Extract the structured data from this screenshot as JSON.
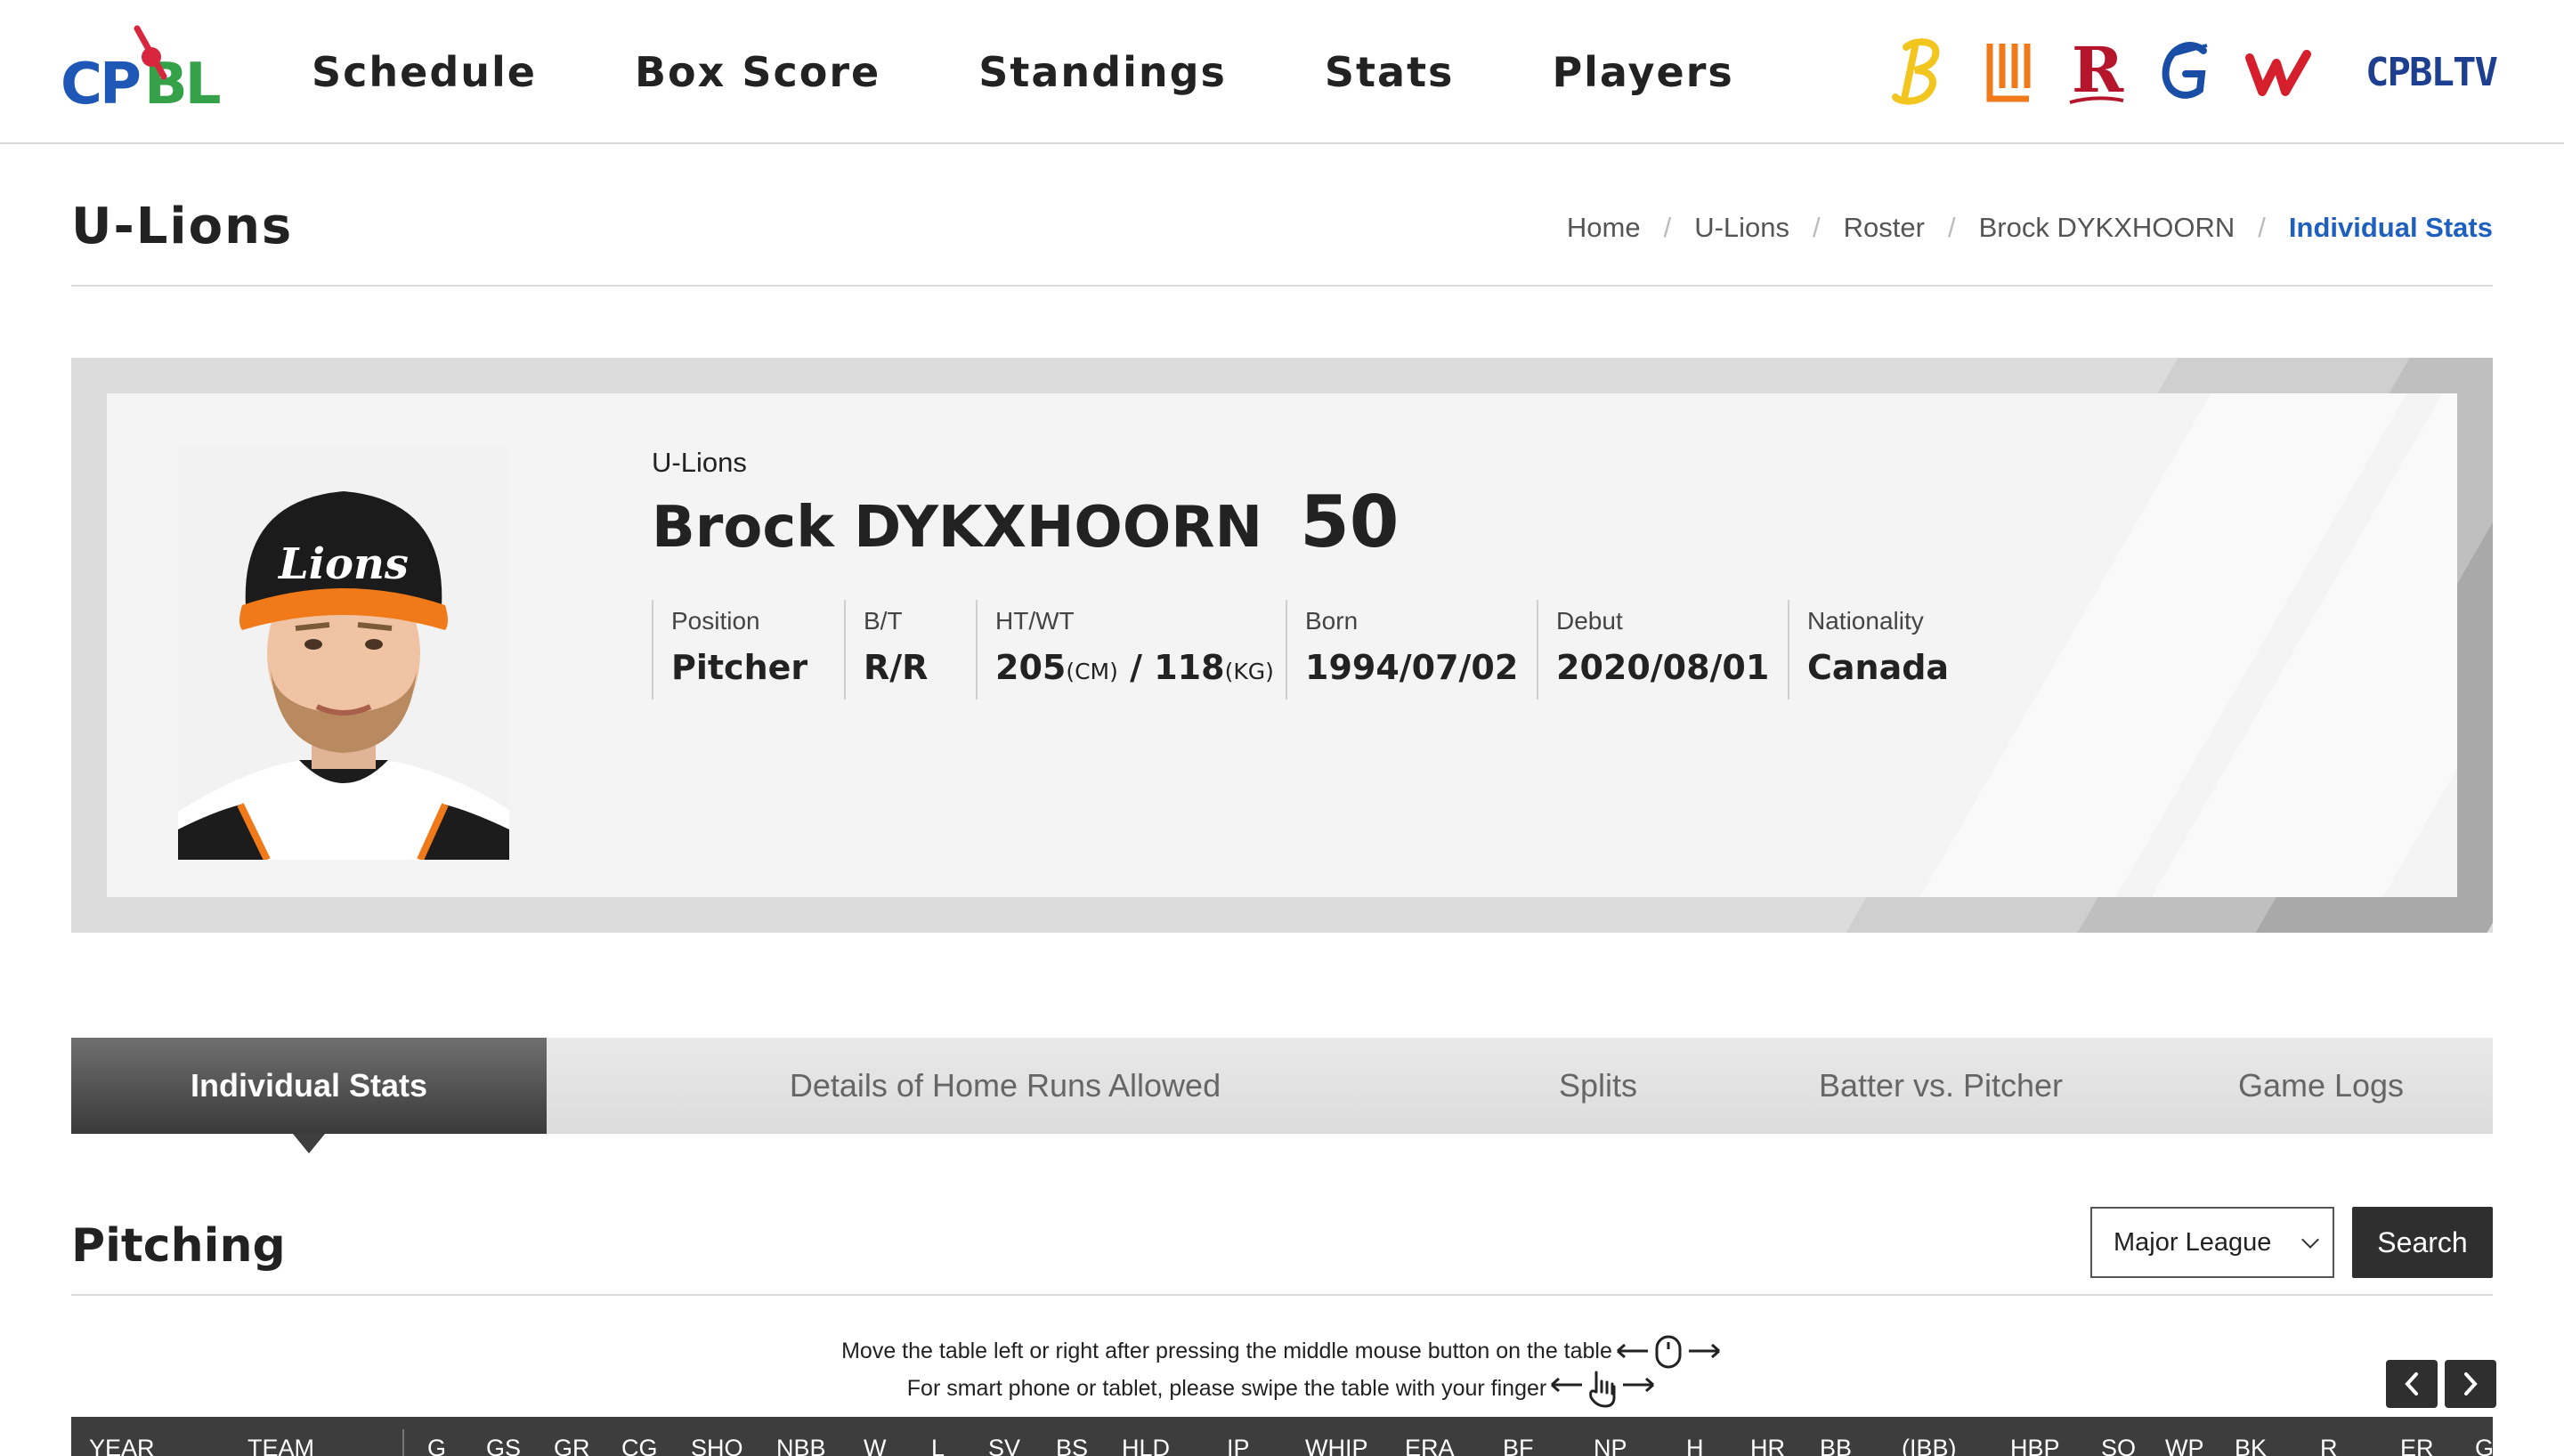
{
  "header": {
    "logo_text": "CPBL",
    "nav": [
      "Schedule",
      "Box Score",
      "Standings",
      "Stats",
      "Players"
    ],
    "team_logos": [
      "brothers-logo",
      "unilions-logo",
      "rakuten-logo",
      "guardians-logo",
      "wedragons-logo"
    ],
    "tv_label": "CPBLTV"
  },
  "page": {
    "title": "U-Lions",
    "breadcrumb": [
      "Home",
      "U-Lions",
      "Roster",
      "Brock DYKXHOORN",
      "Individual Stats"
    ]
  },
  "player": {
    "team": "U-Lions",
    "name": "Brock DYKXHOORN",
    "number": "50",
    "cap_text": "Lions",
    "info": {
      "position": {
        "label": "Position",
        "value": "Pitcher"
      },
      "bt": {
        "label": "B/T",
        "value": "R/R"
      },
      "htwt": {
        "label": "HT/WT",
        "height": "205",
        "height_unit": "(CM)",
        "slash": "/",
        "weight": "118",
        "weight_unit": "(KG)"
      },
      "born": {
        "label": "Born",
        "value": "1994/07/02"
      },
      "debut": {
        "label": "Debut",
        "value": "2020/08/01"
      },
      "nationality": {
        "label": "Nationality",
        "value": "Canada"
      }
    }
  },
  "tabs": [
    "Individual Stats",
    "Details of Home Runs Allowed",
    "Splits",
    "Batter vs. Pitcher",
    "Game Logs"
  ],
  "pitching": {
    "title": "Pitching",
    "league_select": "Major League",
    "search_label": "Search",
    "hint_mouse": "Move the table left or right after pressing the middle mouse button on the table",
    "hint_touch": "For smart phone or tablet, please swipe the table with your finger",
    "columns": [
      "YEAR",
      "TEAM",
      "G",
      "GS",
      "GR",
      "CG",
      "SHO",
      "NBB",
      "W",
      "L",
      "SV",
      "BS",
      "HLD",
      "IP",
      "WHIP",
      "ERA",
      "BF",
      "NP",
      "H",
      "HR",
      "BB",
      "(IBB)",
      "HBP",
      "SO",
      "WP",
      "BK",
      "R",
      "ER",
      "G"
    ]
  },
  "colors": {
    "accent_link": "#1f5fbf",
    "dark_button": "#2f2f2f",
    "table_header": "#3d3d3d",
    "lions_orange": "#f07a1a"
  }
}
